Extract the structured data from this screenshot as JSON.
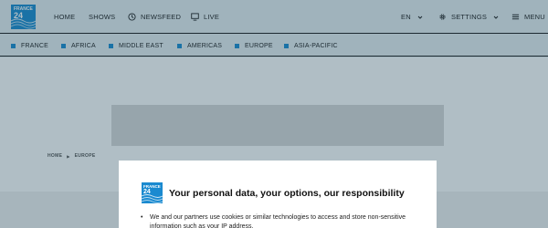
{
  "header": {
    "logo": {
      "line1": "FRANCE",
      "line2": "24"
    },
    "nav": {
      "home": "HOME",
      "shows": "SHOWS",
      "newsfeed": "NEWSFEED",
      "live": "LIVE"
    },
    "language": "EN",
    "settings": "SETTINGS",
    "menu": "MENU"
  },
  "regions": [
    "FRANCE",
    "AFRICA",
    "MIDDLE EAST",
    "AMERICAS",
    "EUROPE",
    "ASIA-PACIFIC"
  ],
  "breadcrumb": {
    "home": "HOME",
    "current": "EUROPE"
  },
  "consent": {
    "logo": {
      "line1": "FRANCE",
      "line2": "24"
    },
    "title": "Your personal data, your options, our responsibility",
    "bullet": "We and our partners use cookies or similar technologies to access and store non-sensitive information such as your IP address."
  },
  "colors": {
    "brand_blue": "#1a8ad0",
    "line": "#1d1d1d"
  }
}
